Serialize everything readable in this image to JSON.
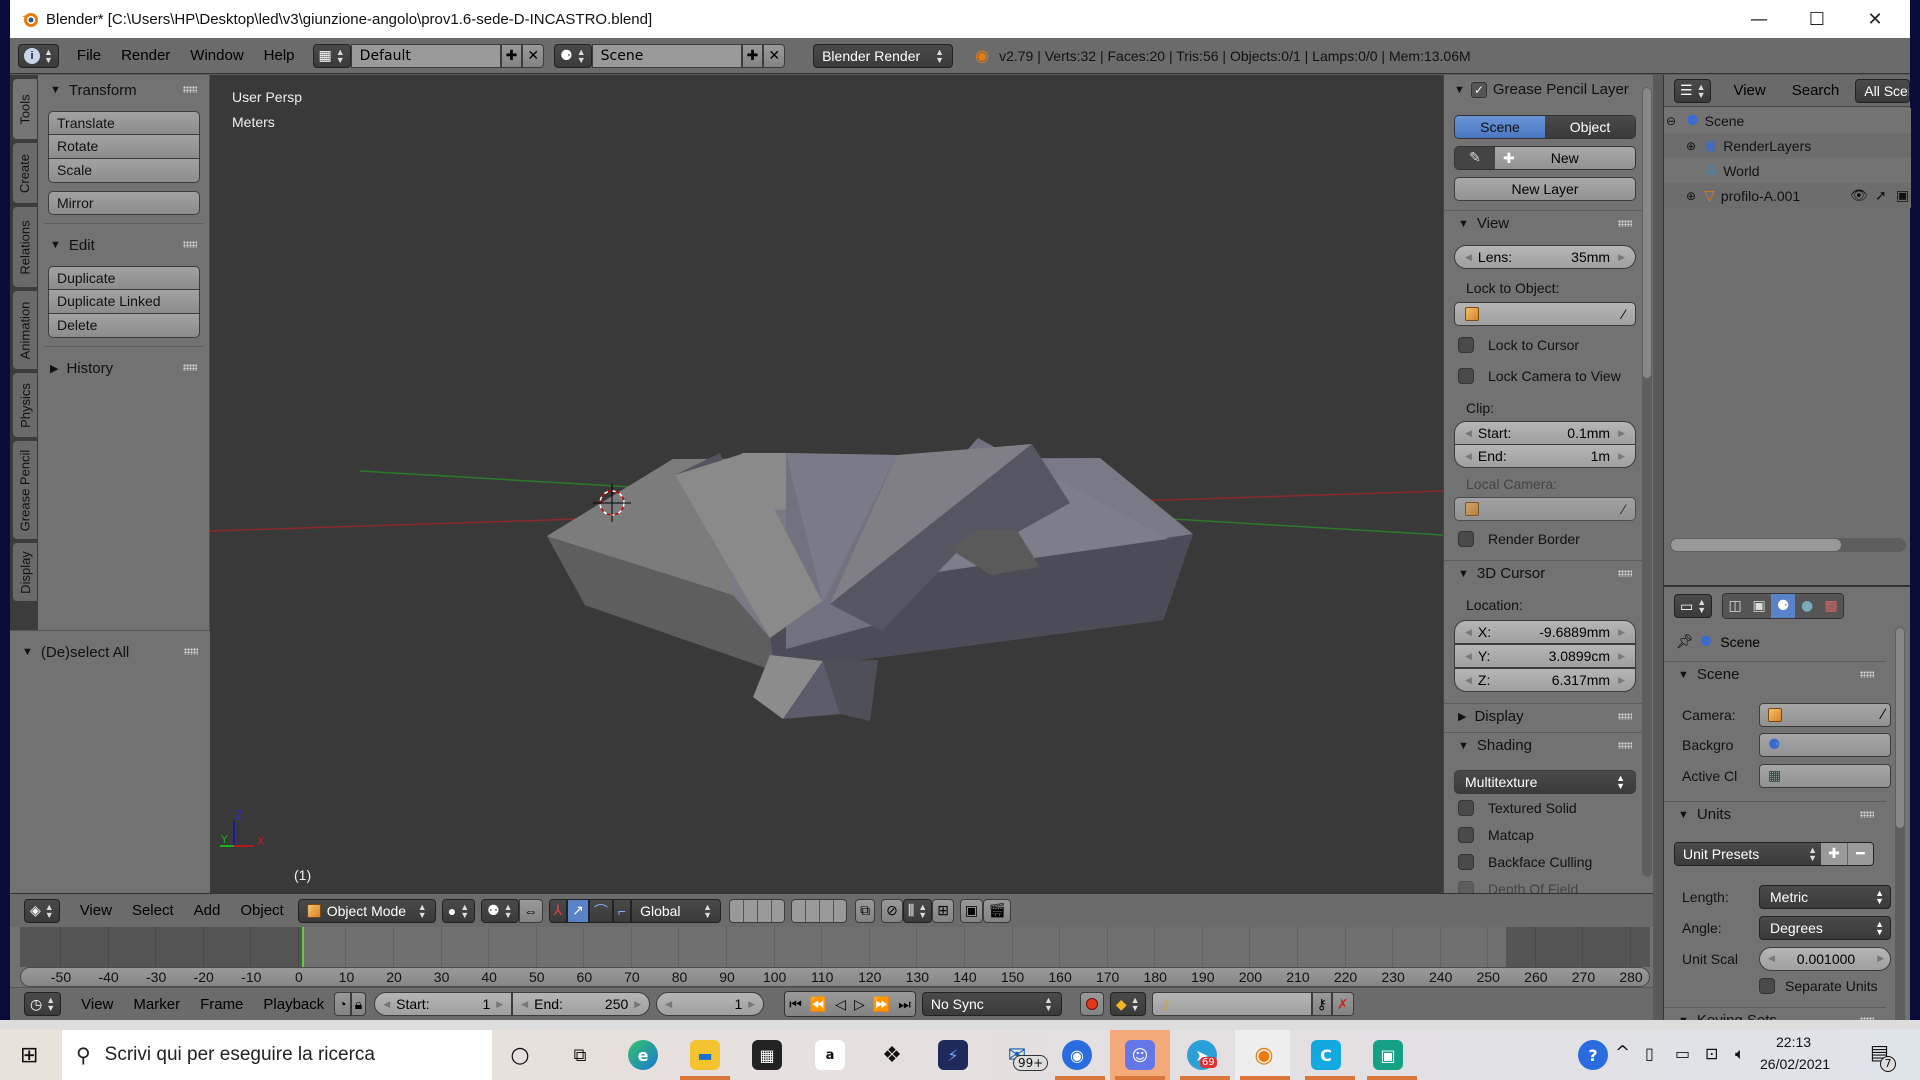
{
  "window": {
    "title": "Blender* [C:\\Users\\HP\\Desktop\\led\\v3\\giunzione-angolo\\prov1.6-sede-D-INCASTRO.blend]",
    "controls": {
      "minimize": "—",
      "maximize": "☐",
      "close": "✕"
    }
  },
  "infobar": {
    "menus": [
      "File",
      "Render",
      "Window",
      "Help"
    ],
    "layout": "Default",
    "scene": "Scene",
    "engine": "Blender Render",
    "stats": "v2.79 | Verts:32 | Faces:20 | Tris:56 | Objects:0/1 | Lamps:0/0 | Mem:13.06M"
  },
  "tool_tabs": [
    "Tools",
    "Create",
    "Relations",
    "Animation",
    "Physics",
    "Grease Pencil",
    "Display"
  ],
  "tool_shelf": {
    "transform": {
      "title": "Transform",
      "buttons": [
        "Translate",
        "Rotate",
        "Scale"
      ],
      "mirror": "Mirror"
    },
    "edit": {
      "title": "Edit",
      "buttons": [
        "Duplicate",
        "Duplicate Linked",
        "Delete"
      ]
    },
    "history": {
      "title": "History"
    },
    "operator": {
      "title": "(De)select All"
    }
  },
  "viewport": {
    "view_name": "User Persp",
    "units": "Meters",
    "frame_indicator": "(1)",
    "axes": {
      "x": "X",
      "y": "Y",
      "z": "Z"
    }
  },
  "npanel": {
    "grease_pencil": {
      "title": "Grease Pencil Layer",
      "checked": true,
      "scene_tab": "Scene",
      "object_tab": "Object",
      "new": "New",
      "new_layer": "New Layer"
    },
    "view": {
      "title": "View",
      "lens_label": "Lens:",
      "lens_value": "35mm",
      "lock_to_object": "Lock to Object:",
      "lock_to_cursor": "Lock to Cursor",
      "lock_camera": "Lock Camera to View",
      "clip": "Clip:",
      "clip_start_label": "Start:",
      "clip_start": "0.1mm",
      "clip_end_label": "End:",
      "clip_end": "1m",
      "local_camera": "Local Camera:",
      "render_border": "Render Border"
    },
    "cursor": {
      "title": "3D Cursor",
      "location": "Location:",
      "x_label": "X:",
      "x": "-9.6889mm",
      "y_label": "Y:",
      "y": "3.0899cm",
      "z_label": "Z:",
      "z": "6.317mm"
    },
    "display": {
      "title": "Display"
    },
    "shading": {
      "title": "Shading",
      "mode": "Multitexture",
      "textured_solid": "Textured Solid",
      "matcap": "Matcap",
      "backface_culling": "Backface Culling",
      "depth_of_field": "Depth Of Field"
    }
  },
  "outliner": {
    "view": "View",
    "search": "Search",
    "filter": "All Scenes",
    "items": [
      {
        "name": "Scene"
      },
      {
        "name": "RenderLayers"
      },
      {
        "name": "World"
      },
      {
        "name": "profilo-A.001"
      }
    ]
  },
  "properties": {
    "context": "Scene",
    "scene_panel": {
      "title": "Scene",
      "camera": "Camera:",
      "background": "Backgro",
      "active_clip": "Active Cl"
    },
    "units_panel": {
      "title": "Units",
      "presets": "Unit Presets",
      "length_label": "Length:",
      "length": "Metric",
      "angle_label": "Angle:",
      "angle": "Degrees",
      "scale_label": "Unit Scal",
      "scale": "0.001000",
      "separate_units": "Separate Units"
    },
    "keying_sets": {
      "title": "Keying Sets"
    }
  },
  "view3d_header": {
    "menus": [
      "View",
      "Select",
      "Add",
      "Object"
    ],
    "mode": "Object Mode",
    "orientation": "Global"
  },
  "timeline": {
    "ticks": [
      "-50",
      "-40",
      "-30",
      "-20",
      "-10",
      "0",
      "10",
      "20",
      "30",
      "40",
      "50",
      "60",
      "70",
      "80",
      "90",
      "100",
      "110",
      "120",
      "130",
      "140",
      "150",
      "160",
      "170",
      "180",
      "190",
      "200",
      "210",
      "220",
      "230",
      "240",
      "250",
      "260",
      "270",
      "280"
    ],
    "current_frame": 1,
    "menus": [
      "View",
      "Marker",
      "Frame",
      "Playback"
    ],
    "start_label": "Start:",
    "start": "1",
    "end_label": "End:",
    "end": "250",
    "frame": "1",
    "sync": "No Sync"
  },
  "taskbar": {
    "search_placeholder": "Scrivi qui per eseguire la ricerca",
    "mail_badge": "99+",
    "telegram_badge": "69",
    "time": "22:13",
    "date": "26/02/2021",
    "notifications": "7"
  }
}
